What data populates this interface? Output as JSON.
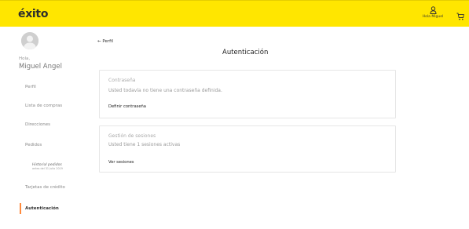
{
  "header": {
    "logo": "éxito",
    "account_label": "Hola Miguel",
    "colors": {
      "bar": "#ffe600",
      "accent": "#ff8a3d"
    },
    "icons": [
      "user-icon",
      "cart-icon"
    ]
  },
  "sidebar": {
    "greeting": "Hola,",
    "user_name": "Miguel Angel",
    "items": [
      {
        "label": "Perfil"
      },
      {
        "label": "Lista de compras"
      },
      {
        "label": "Direcciones"
      },
      {
        "label": "Pedidos"
      },
      {
        "label": "Tarjetas de crédito"
      },
      {
        "label": "Autenticación"
      }
    ],
    "history": {
      "title": "Historial pedidos",
      "subtitle": "antes del 31 Julio 2019"
    },
    "active_item": "Autenticación"
  },
  "main": {
    "back_label": "← Perfil",
    "title": "Autenticación",
    "cards": [
      {
        "title": "Contraseña",
        "description": "Usted todavía no tiene una contraseña definida.",
        "link": "Definir contraseña"
      },
      {
        "title": "Gestión de sesiones",
        "description": "Usted tiene 1 sesiones activas",
        "link": "Ver sesiones"
      }
    ]
  }
}
